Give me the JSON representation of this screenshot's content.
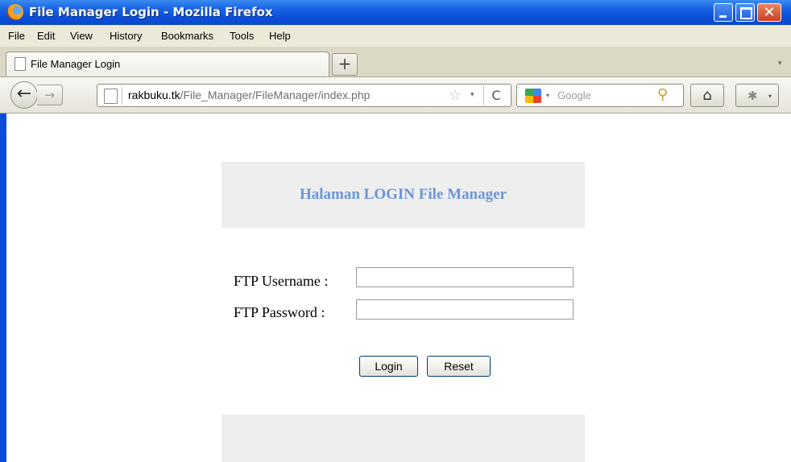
{
  "window": {
    "title": "File Manager Login - Mozilla Firefox",
    "close_glyph": "✕"
  },
  "menubar": {
    "items": [
      "File",
      "Edit",
      "View",
      "History",
      "Bookmarks",
      "Tools",
      "Help"
    ]
  },
  "tabs": {
    "active_label": "File Manager Login",
    "new_tab_glyph": "+",
    "list_glyph": "▾"
  },
  "navbar": {
    "url_host": "rakbuku.tk",
    "url_path": "/File_Manager/FileManager/index.php",
    "search_placeholder": "Google",
    "icons": [
      "back-icon",
      "forward-icon",
      "page-icon",
      "bookmark-star-icon",
      "reload-icon",
      "google-icon",
      "search-icon",
      "home-icon",
      "addon-icon"
    ],
    "back_glyph": "←",
    "forward_glyph": "→",
    "star_glyph": "☆",
    "dropdown_glyph": "▾",
    "reload_glyph": "C",
    "search_glyph": "⚲",
    "home_glyph": "⌂",
    "addon_glyph": "✱"
  },
  "page": {
    "header_title": "Halaman LOGIN File Manager",
    "username_label": "FTP Username :",
    "password_label": "FTP Password :",
    "username_value": "",
    "password_value": "",
    "login_label": "Login",
    "reset_label": "Reset"
  },
  "colors": {
    "titlebar": "#0b4fd9",
    "header_text": "#6b95d8",
    "box_bg": "#eeeeee"
  }
}
